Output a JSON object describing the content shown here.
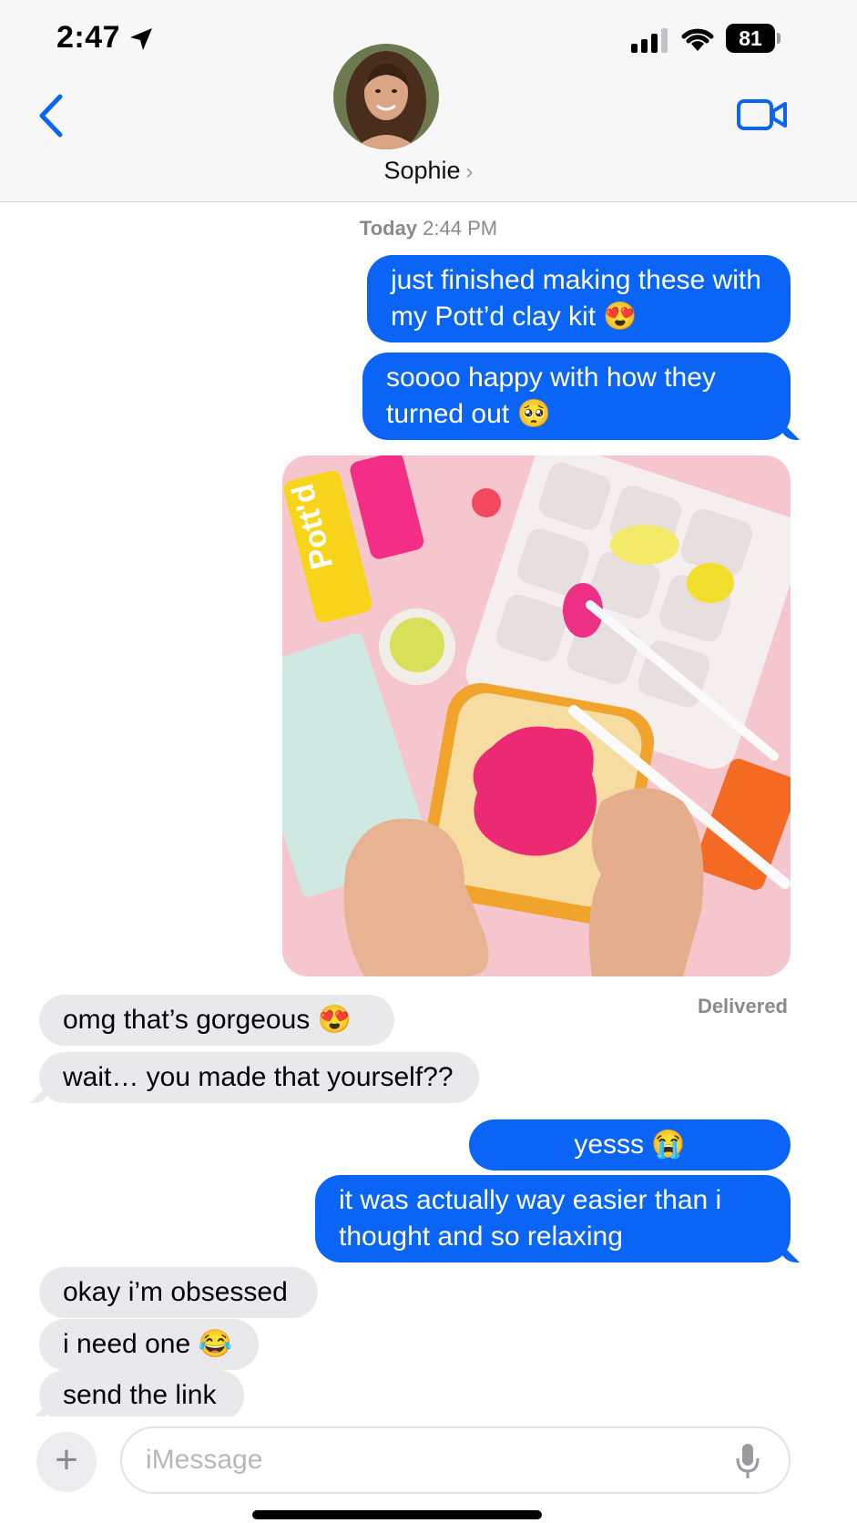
{
  "status_bar": {
    "time": "2:47",
    "battery": "81"
  },
  "header": {
    "contact_name": "Sophie",
    "chevron": "›"
  },
  "thread": {
    "timestamp_day": "Today",
    "timestamp_time": "2:44 PM",
    "messages": [
      {
        "from": "me",
        "text": "just finished making these with my Pott’d clay kit 😍"
      },
      {
        "from": "me",
        "text": "soooo happy with how they turned out 🥺"
      },
      {
        "from": "me",
        "type": "photo"
      },
      {
        "from": "them",
        "text": "omg that’s gorgeous 😍"
      },
      {
        "from": "them",
        "text": "wait… you made that yourself??"
      },
      {
        "from": "me",
        "text": "yesss 😭"
      },
      {
        "from": "me",
        "text": "it was actually way easier than i thought and so relaxing"
      },
      {
        "from": "them",
        "text": "okay i’m obsessed"
      },
      {
        "from": "them",
        "text": "i need one 😂"
      },
      {
        "from": "them",
        "text": "send the link"
      }
    ],
    "delivered": "Delivered"
  },
  "input": {
    "placeholder": "iMessage",
    "value": "",
    "plus": "+"
  },
  "icons": {
    "back": "chevron-left-icon",
    "video": "video-camera-icon",
    "location": "location-arrow-icon",
    "signal": "cellular-signal-icon",
    "wifi": "wifi-icon",
    "mic": "microphone-icon"
  },
  "colors": {
    "accent": "#0a64f5",
    "incoming": "#e9e9eb",
    "header_bg": "#f7f7f8"
  }
}
